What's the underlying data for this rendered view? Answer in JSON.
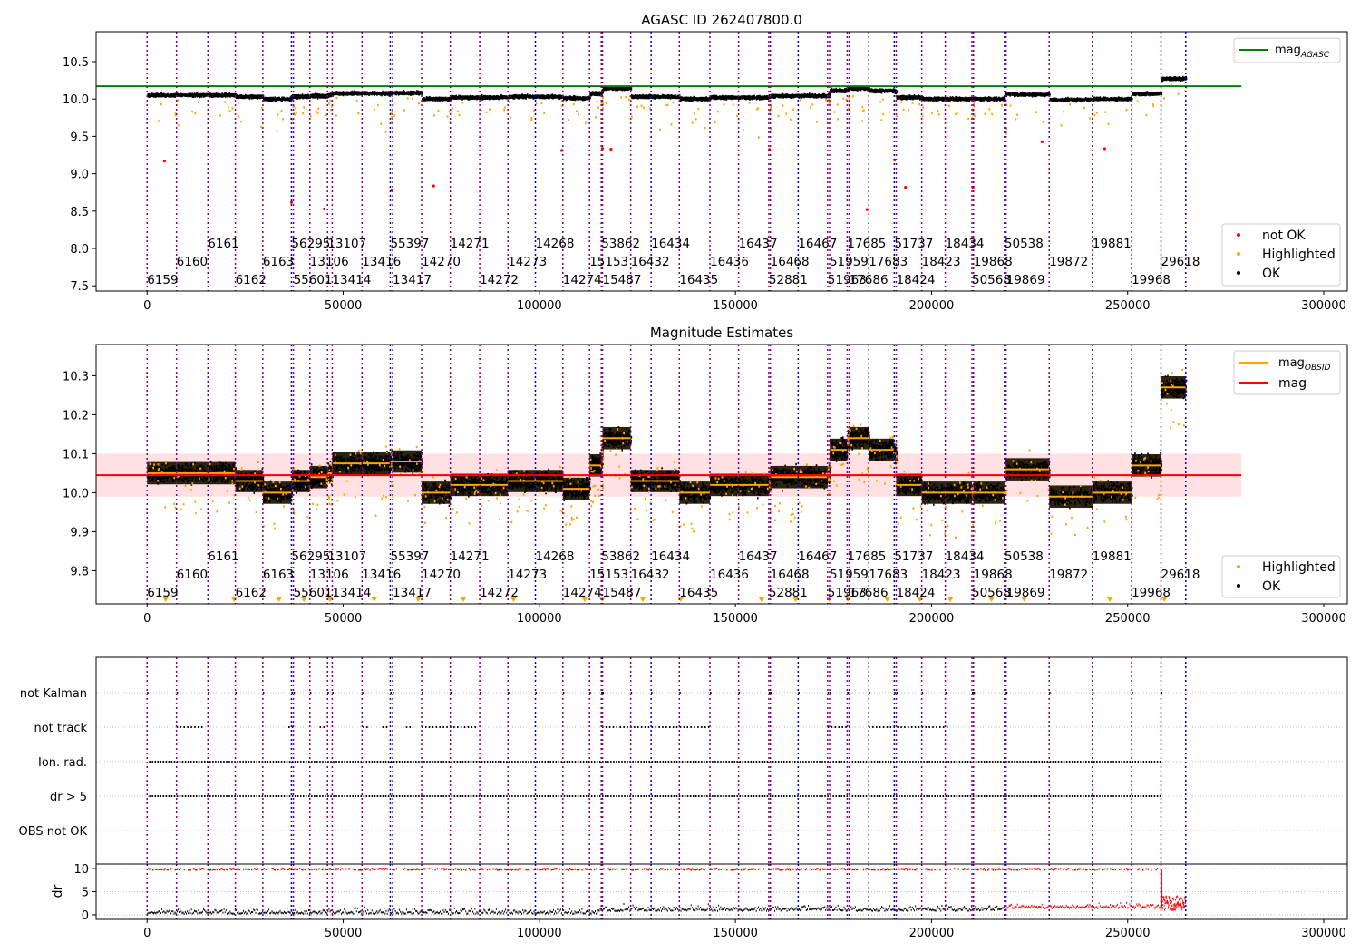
{
  "colors": {
    "ok": "#000000",
    "highlighted": "#ffa500",
    "not_ok": "#ff0000",
    "mag_agasc_line": "#008000",
    "mag_obsid_line": "#ffa500",
    "mag_line": "#ff0000",
    "mag_band": "#ffdde0",
    "obs_boundary": "#800080",
    "obs_boundary_alt": "#0000cd",
    "grid": "#b0b0b0"
  },
  "chart_data": [
    {
      "type": "scatter",
      "title": "AGASC ID 262407800.0",
      "xlim": [
        -13000,
        306000
      ],
      "ylim": [
        7.43,
        10.9
      ],
      "xticks": [
        0,
        50000,
        100000,
        150000,
        200000,
        250000,
        300000
      ],
      "yticks": [
        7.5,
        8.0,
        8.5,
        9.0,
        9.5,
        10.0,
        10.5
      ],
      "mag_agasc": 10.17,
      "legend_upper": {
        "position": "upper-right",
        "entries": [
          {
            "label": "mag",
            "sub": "AGASC"
          }
        ]
      },
      "legend_lower": {
        "position": "lower-right",
        "entries": [
          "not OK",
          "Highlighted",
          "OK"
        ]
      },
      "series": [
        {
          "name": "OK",
          "points": "black per-observation dense band following the OBSID magnitudes"
        },
        {
          "name": "Highlighted",
          "points": "orange scattered points mostly between 8.9 and 10.3"
        },
        {
          "name": "not OK",
          "points": "red sparse points"
        }
      ]
    },
    {
      "type": "scatter",
      "title": "Magnitude Estimates",
      "xlim": [
        -13000,
        306000
      ],
      "ylim": [
        9.715,
        10.38
      ],
      "xticks": [
        0,
        50000,
        100000,
        150000,
        200000,
        250000,
        300000
      ],
      "yticks": [
        9.8,
        9.9,
        10.0,
        10.1,
        10.2,
        10.3
      ],
      "mag": 10.045,
      "mag_band": [
        9.99,
        10.1
      ],
      "legend_upper": {
        "position": "upper-right",
        "entries": [
          {
            "label": "mag",
            "sub": "OBSID"
          },
          {
            "label": "mag",
            "sub": ""
          }
        ]
      },
      "legend_lower": {
        "position": "lower-right",
        "entries": [
          "Highlighted",
          "OK"
        ]
      }
    },
    {
      "type": "scatter",
      "title": "",
      "xlim": [
        -13000,
        306000
      ],
      "categories": [
        "not Kalman",
        "not track",
        "Ion. rad.",
        "dr > 5",
        "OBS not OK"
      ],
      "dr_ylim": [
        -1,
        11
      ],
      "dr_yticks": [
        0,
        5,
        10
      ],
      "ylabel": "dr",
      "xticks": [
        0,
        50000,
        100000,
        150000,
        200000,
        250000,
        300000
      ]
    }
  ],
  "observations": [
    {
      "obsid": "6159",
      "start": 0,
      "end": 7500,
      "mag": 10.05,
      "level": 0
    },
    {
      "obsid": "6160",
      "start": 7500,
      "end": 15500,
      "mag": 10.05,
      "level": 1
    },
    {
      "obsid": "6161",
      "start": 15500,
      "end": 22500,
      "mag": 10.05,
      "level": 2
    },
    {
      "obsid": "6162",
      "start": 22500,
      "end": 29500,
      "mag": 10.03,
      "level": 0
    },
    {
      "obsid": "6163",
      "start": 29500,
      "end": 36800,
      "mag": 10.0,
      "level": 1
    },
    {
      "obsid": "56295",
      "start": 36800,
      "end": 37300,
      "mag": 10.03,
      "level": 2
    },
    {
      "obsid": "55601",
      "start": 37300,
      "end": 41500,
      "mag": 10.03,
      "level": 0
    },
    {
      "obsid": "13106",
      "start": 41500,
      "end": 46000,
      "mag": 10.04,
      "level": 1
    },
    {
      "obsid": "13107",
      "start": 46000,
      "end": 47200,
      "mag": 10.05,
      "level": 2
    },
    {
      "obsid": "13414",
      "start": 47200,
      "end": 54800,
      "mag": 10.075,
      "level": 0
    },
    {
      "obsid": "13416",
      "start": 54800,
      "end": 62000,
      "mag": 10.075,
      "level": 1
    },
    {
      "obsid": "55397",
      "start": 62000,
      "end": 62600,
      "mag": 10.08,
      "level": 2
    },
    {
      "obsid": "13417",
      "start": 62600,
      "end": 70000,
      "mag": 10.08,
      "level": 0
    },
    {
      "obsid": "14270",
      "start": 70000,
      "end": 77300,
      "mag": 10.0,
      "level": 1
    },
    {
      "obsid": "14271",
      "start": 77300,
      "end": 84800,
      "mag": 10.02,
      "level": 2
    },
    {
      "obsid": "14272",
      "start": 84800,
      "end": 92000,
      "mag": 10.02,
      "level": 0
    },
    {
      "obsid": "14273",
      "start": 92000,
      "end": 99000,
      "mag": 10.03,
      "level": 1
    },
    {
      "obsid": "14268",
      "start": 99000,
      "end": 106000,
      "mag": 10.03,
      "level": 2
    },
    {
      "obsid": "14274",
      "start": 106000,
      "end": 112800,
      "mag": 10.01,
      "level": 0
    },
    {
      "obsid": "15153",
      "start": 112800,
      "end": 115800,
      "mag": 10.07,
      "level": 1
    },
    {
      "obsid": "53862",
      "start": 115800,
      "end": 116100,
      "mag": 10.1,
      "level": 2
    },
    {
      "obsid": "15487",
      "start": 116100,
      "end": 123300,
      "mag": 10.14,
      "level": 0
    },
    {
      "obsid": "16432",
      "start": 123300,
      "end": 128500,
      "mag": 10.03,
      "level": 1
    },
    {
      "obsid": "16434",
      "start": 128500,
      "end": 135700,
      "mag": 10.03,
      "level": 2
    },
    {
      "obsid": "16435",
      "start": 135700,
      "end": 143500,
      "mag": 10.0,
      "level": 0
    },
    {
      "obsid": "16436",
      "start": 143500,
      "end": 150800,
      "mag": 10.02,
      "level": 1
    },
    {
      "obsid": "16437",
      "start": 150800,
      "end": 158500,
      "mag": 10.02,
      "level": 2
    },
    {
      "obsid": "52881",
      "start": 158500,
      "end": 158900,
      "mag": 10.03,
      "level": 0
    },
    {
      "obsid": "16468",
      "start": 158900,
      "end": 166000,
      "mag": 10.04,
      "level": 1
    },
    {
      "obsid": "16467",
      "start": 166000,
      "end": 173500,
      "mag": 10.04,
      "level": 2
    },
    {
      "obsid": "51963",
      "start": 173500,
      "end": 174000,
      "mag": 10.05,
      "level": 0
    },
    {
      "obsid": "51959",
      "start": 174000,
      "end": 178500,
      "mag": 10.11,
      "level": 1
    },
    {
      "obsid": "17685",
      "start": 178500,
      "end": 179000,
      "mag": 10.14,
      "level": 2
    },
    {
      "obsid": "17686",
      "start": 179000,
      "end": 184000,
      "mag": 10.14,
      "level": 0
    },
    {
      "obsid": "17683",
      "start": 184000,
      "end": 190500,
      "mag": 10.11,
      "level": 1
    },
    {
      "obsid": "51737",
      "start": 190500,
      "end": 191000,
      "mag": 10.1,
      "level": 2
    },
    {
      "obsid": "18424",
      "start": 191000,
      "end": 197500,
      "mag": 10.02,
      "level": 0
    },
    {
      "obsid": "18423",
      "start": 197500,
      "end": 203500,
      "mag": 10.0,
      "level": 1
    },
    {
      "obsid": "18434",
      "start": 203500,
      "end": 210300,
      "mag": 10.0,
      "level": 2
    },
    {
      "obsid": "50568",
      "start": 210300,
      "end": 210700,
      "mag": 10.0,
      "level": 0
    },
    {
      "obsid": "19868",
      "start": 210700,
      "end": 218600,
      "mag": 10.0,
      "level": 1
    },
    {
      "obsid": "50538",
      "start": 218600,
      "end": 219000,
      "mag": 10.06,
      "level": 2
    },
    {
      "obsid": "19869",
      "start": 219000,
      "end": 230000,
      "mag": 10.06,
      "level": 0
    },
    {
      "obsid": "19872",
      "start": 230000,
      "end": 241000,
      "mag": 9.99,
      "level": 1
    },
    {
      "obsid": "19881",
      "start": 241000,
      "end": 251000,
      "mag": 10.0,
      "level": 2
    },
    {
      "obsid": "19968",
      "start": 251000,
      "end": 258500,
      "mag": 10.07,
      "level": 0
    },
    {
      "obsid": "29618",
      "start": 258500,
      "end": 264800,
      "mag": 10.27,
      "level": 1
    }
  ]
}
